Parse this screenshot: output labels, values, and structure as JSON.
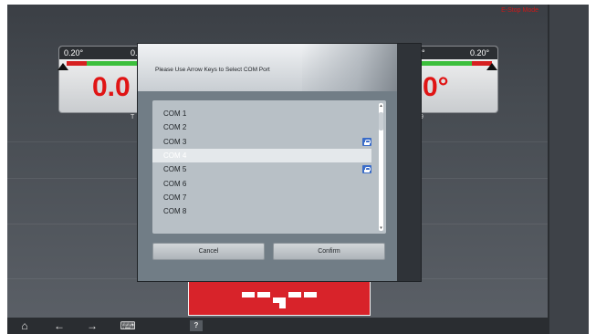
{
  "app": {
    "warning_text": "E-Stop Mode",
    "left_gauge": {
      "min_label": "0.20°",
      "max_label": "0.",
      "big_value": "0.0",
      "sub_label": "T"
    },
    "right_gauge": {
      "min_label": "0°",
      "max_label": "0.20°",
      "big_value": "0°",
      "sub_label": "9"
    }
  },
  "dialog": {
    "title": "Please Use Arrow Keys to Select COM Port",
    "ports": [
      {
        "label": "COM 1",
        "locked": false,
        "selected": false
      },
      {
        "label": "COM 2",
        "locked": false,
        "selected": false
      },
      {
        "label": "COM 3",
        "locked": true,
        "selected": false
      },
      {
        "label": "COM 4",
        "locked": false,
        "selected": true
      },
      {
        "label": "COM 5",
        "locked": true,
        "selected": false
      },
      {
        "label": "COM 6",
        "locked": false,
        "selected": false
      },
      {
        "label": "COM 7",
        "locked": false,
        "selected": false
      },
      {
        "label": "COM 8",
        "locked": false,
        "selected": false
      }
    ],
    "scroll_up_glyph": "▴",
    "scroll_down_glyph": "▾",
    "cancel_label": "Cancel",
    "confirm_label": "Confirm"
  },
  "toolbar": {
    "home_icon": "⌂",
    "back_icon": "←",
    "forward_icon": "→",
    "keyboard_icon": "⌨",
    "help_icon": "?"
  },
  "colors": {
    "accent_red": "#d8232a",
    "selection": "#e4e8eb",
    "lock_blue": "#3a6cc8"
  }
}
